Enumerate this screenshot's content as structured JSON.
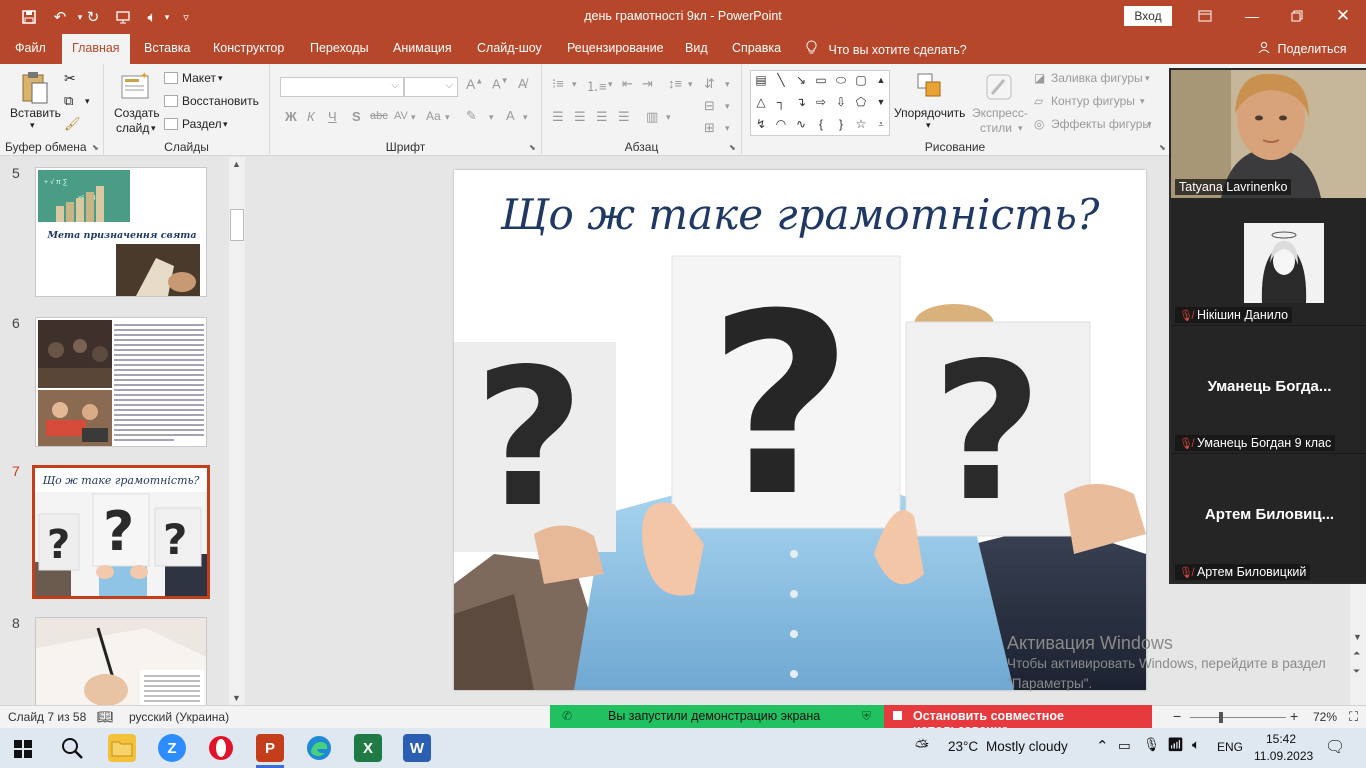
{
  "window": {
    "title": "день грамотності 9кл  -  PowerPoint",
    "signin_label": "Вход"
  },
  "tabs": [
    {
      "label": "Файл"
    },
    {
      "label": "Главная"
    },
    {
      "label": "Вставка"
    },
    {
      "label": "Конструктор"
    },
    {
      "label": "Переходы"
    },
    {
      "label": "Анимация"
    },
    {
      "label": "Слайд-шоу"
    },
    {
      "label": "Рецензирование"
    },
    {
      "label": "Вид"
    },
    {
      "label": "Справка"
    }
  ],
  "tell_me": "Что вы хотите сделать?",
  "share_label": "Поделиться",
  "ribbon": {
    "clipboard": {
      "paste": "Вставить",
      "label": "Буфер обмена"
    },
    "slides": {
      "new_slide_1": "Создать",
      "new_slide_2": "слайд",
      "layout": "Макет",
      "reset": "Восстановить",
      "section": "Раздел",
      "label": "Слайды"
    },
    "font": {
      "label": "Шрифт",
      "bold": "Ж",
      "italic": "К",
      "underline": "Ч",
      "shadow": "S",
      "strike": "abc",
      "spacing": "AV",
      "case": "Aa",
      "color": "A"
    },
    "paragraph": {
      "label": "Абзац"
    },
    "drawing": {
      "arrange_1": "Упорядочить",
      "styles_1": "Экспресс-",
      "styles_2": "стили",
      "fill": "Заливка фигуры",
      "outline": "Контур фигуры",
      "effects": "Эффекты фигуры",
      "label": "Рисование"
    }
  },
  "thumbnails": [
    {
      "number": "5",
      "caption": "Мета призначення  свята"
    },
    {
      "number": "6",
      "caption": ""
    },
    {
      "number": "7",
      "caption": "Що ж таке грамотність?"
    },
    {
      "number": "8",
      "caption": ""
    }
  ],
  "slide": {
    "title": "Що ж таке грамотність?"
  },
  "watermark": {
    "title": "Активация Windows",
    "subtitle": "Чтобы активировать Windows, перейдите в раздел \"Параметры\"."
  },
  "participants": [
    {
      "name": "Tatyana Lavrinenko",
      "big": ""
    },
    {
      "name": "Нікішин Данило",
      "big": ""
    },
    {
      "name": "Уманець Богдан 9 клас",
      "big": "Уманець  Богда..."
    },
    {
      "name": "Артем Биловицкий",
      "big": "Артем  Биловиц..."
    }
  ],
  "status": {
    "slide_pos": "Слайд 7 из 58",
    "language": "русский (Украина)",
    "zoom": "72%",
    "zoom_minus": "−",
    "zoom_plus": "+"
  },
  "share_banner": {
    "sharing": "Вы запустили демонстрацию экрана",
    "stop": "Остановить совместное использование"
  },
  "taskbar": {
    "weather_temp": "23°C",
    "weather_desc": "Mostly cloudy",
    "lang": "ENG",
    "time": "15:42",
    "date": "11.09.2023"
  },
  "colors": {
    "accent": "#b7472a",
    "active_thumb": "#c43e1c",
    "share_green": "#21c161",
    "stop_red": "#e63a3f",
    "slide_title": "#1f3864"
  }
}
